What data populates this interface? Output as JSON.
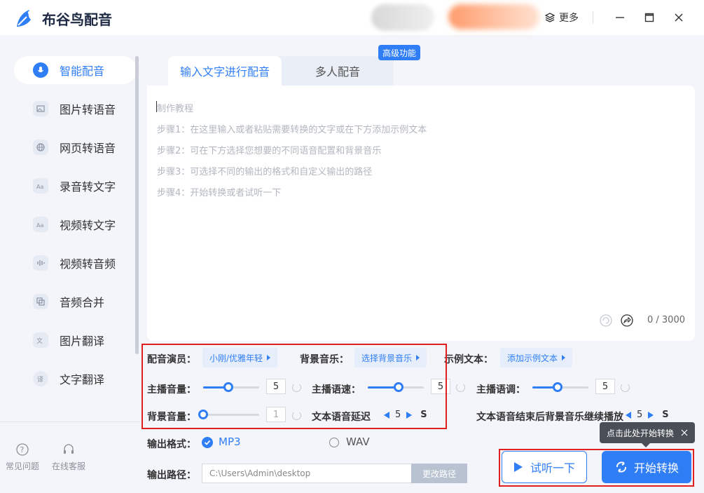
{
  "app": {
    "title": "布谷鸟配音",
    "more_label": "更多",
    "brand_color": "#2f7ef5"
  },
  "sidebar": {
    "items": [
      {
        "label": "智能配音",
        "icon": "microphone-icon"
      },
      {
        "label": "图片转语音",
        "icon": "image-icon"
      },
      {
        "label": "网页转语音",
        "icon": "globe-icon"
      },
      {
        "label": "录音转文字",
        "icon": "text-aa-icon"
      },
      {
        "label": "视频转文字",
        "icon": "video-text-icon"
      },
      {
        "label": "视频转音频",
        "icon": "waveform-icon"
      },
      {
        "label": "音频合并",
        "icon": "merge-icon"
      },
      {
        "label": "图片翻译",
        "icon": "translate-icon"
      },
      {
        "label": "文字翻译",
        "icon": "chat-translate-icon"
      }
    ],
    "bottom": {
      "faq_label": "常见问题",
      "service_label": "在线客服"
    }
  },
  "tabs": {
    "active_label": "输入文字进行配音",
    "multi_label": "多人配音",
    "badge": "高级功能"
  },
  "editor": {
    "lines": [
      "制作教程",
      "步骤1：在这里输入或者粘贴需要转换的文字或在下方添加示例文本",
      "步骤2：可在下方选择您想要的不同语音配置和背景音乐",
      "步骤3：可选择不同的输出的格式和自定义输出的路径",
      "步骤4：开始转换或者试听一下"
    ],
    "count": "0 / 3000"
  },
  "settings": {
    "voice_label": "配音演员：",
    "voice_value": "小刚/优雅年轻",
    "bgm_label": "背景音乐：",
    "bgm_value": "选择背景音乐",
    "sample_label": "示例文本：",
    "sample_value": "添加示例文本",
    "main_volume_label": "主播音量：",
    "main_volume": "5",
    "main_volume_level": 0.45,
    "speed_label": "主播语速：",
    "speed": "5",
    "speed_level": 0.55,
    "pitch_label": "主播语调：",
    "pitch": "5",
    "pitch_level": 0.45,
    "bg_volume_label": "背景音量：",
    "bg_volume": "1",
    "bg_volume_level": 0.0,
    "delay_label": "文本语音延迟",
    "delay": "5",
    "delay_unit": "S",
    "continue_label": "文本语音结束后背景音乐继续播放",
    "continue": "5",
    "continue_unit": "S"
  },
  "output": {
    "format_label": "输出格式：",
    "mp3": "MP3",
    "wav": "WAV",
    "path_label": "输出路径：",
    "path": "C:\\Users\\Admin\\desktop",
    "change_path": "更改路径"
  },
  "actions": {
    "try_label": "试听一下",
    "start_label": "开始转换",
    "tooltip": "点击此处开始转换"
  }
}
